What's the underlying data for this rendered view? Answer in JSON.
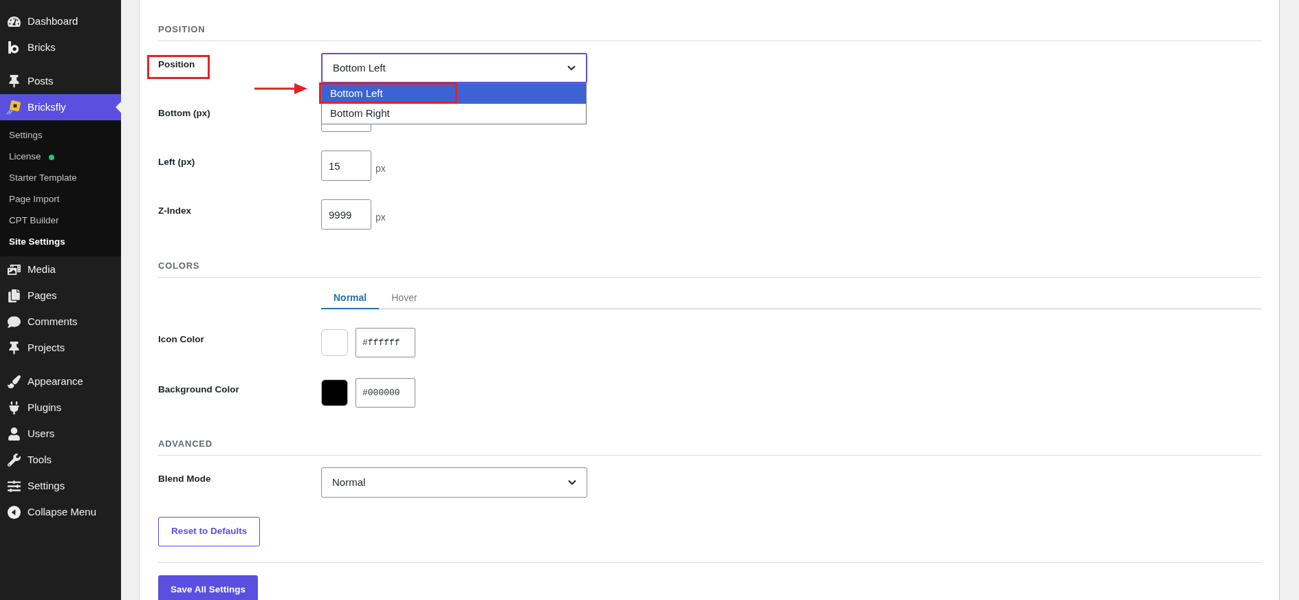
{
  "sidebar": {
    "groups": [
      {
        "items": [
          {
            "label": "Dashboard",
            "selected": false
          },
          {
            "label": "Bricks",
            "selected": false
          }
        ]
      },
      {
        "items": [
          {
            "label": "Posts",
            "selected": false
          },
          {
            "label": "Bricksfly",
            "selected": true,
            "expanded": true,
            "children": [
              {
                "label": "Settings",
                "selected": false
              },
              {
                "label": "License",
                "selected": false,
                "color": "#1ec773"
              },
              {
                "label": "Starter Template",
                "selected": false
              },
              {
                "label": "Page Import",
                "selected": false
              },
              {
                "label": "CPT Builder",
                "selected": false
              },
              {
                "label": "Site Settings",
                "selected": true
              }
            ]
          },
          {
            "label": "Media",
            "selected": false
          },
          {
            "label": "Pages",
            "selected": false
          },
          {
            "label": "Comments",
            "selected": false
          },
          {
            "label": "Projects",
            "selected": false
          }
        ]
      },
      {
        "items": [
          {
            "label": "Appearance",
            "selected": false
          },
          {
            "label": "Plugins",
            "selected": false
          },
          {
            "label": "Users",
            "selected": false
          },
          {
            "label": "Tools",
            "selected": false
          },
          {
            "label": "Settings",
            "selected": false
          }
        ]
      }
    ],
    "collapse_button": {
      "label": "Collapse Menu"
    }
  },
  "settings": {
    "sections": [
      {
        "heading": "POSITION",
        "fields": [
          {
            "kind": "select",
            "label": "Position",
            "highlighted": true,
            "value": "Bottom Left",
            "expanded": true,
            "options": [
              {
                "label": "Bottom Left",
                "selected": true,
                "highlighted": true,
                "arrow": true
              },
              {
                "label": "Bottom Right",
                "selected": false
              }
            ]
          },
          {
            "kind": "number",
            "label": "Bottom (px)"
          },
          {
            "kind": "number",
            "label": "Left (px)",
            "value": "15",
            "unit": "px"
          },
          {
            "kind": "number",
            "label": "Z-Index",
            "value": "9999",
            "unit": "px"
          }
        ]
      },
      {
        "heading": "COLORS",
        "tabs": [
          {
            "label": "Normal",
            "selected": true
          },
          {
            "label": "Hover",
            "selected": false
          }
        ],
        "fields": [
          {
            "kind": "color",
            "label": "Icon Color",
            "color": "#ffffff",
            "value": "#ffffff"
          },
          {
            "kind": "color",
            "label": "Background Color",
            "color": "#000000",
            "value": "#000000"
          }
        ]
      },
      {
        "heading": "ADVANCED",
        "fields": [
          {
            "kind": "select",
            "label": "Blend Mode",
            "value": "Normal",
            "expanded": false
          }
        ]
      }
    ],
    "reset_button": {
      "label": "Reset to Defaults"
    },
    "save_button": {
      "label": "Save All Settings"
    }
  }
}
